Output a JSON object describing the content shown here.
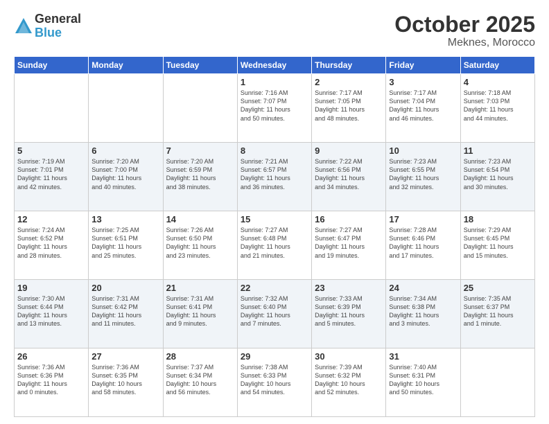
{
  "logo": {
    "general": "General",
    "blue": "Blue"
  },
  "header": {
    "month": "October 2025",
    "location": "Meknes, Morocco"
  },
  "weekdays": [
    "Sunday",
    "Monday",
    "Tuesday",
    "Wednesday",
    "Thursday",
    "Friday",
    "Saturday"
  ],
  "weeks": [
    [
      {
        "day": "",
        "info": ""
      },
      {
        "day": "",
        "info": ""
      },
      {
        "day": "",
        "info": ""
      },
      {
        "day": "1",
        "info": "Sunrise: 7:16 AM\nSunset: 7:07 PM\nDaylight: 11 hours\nand 50 minutes."
      },
      {
        "day": "2",
        "info": "Sunrise: 7:17 AM\nSunset: 7:05 PM\nDaylight: 11 hours\nand 48 minutes."
      },
      {
        "day": "3",
        "info": "Sunrise: 7:17 AM\nSunset: 7:04 PM\nDaylight: 11 hours\nand 46 minutes."
      },
      {
        "day": "4",
        "info": "Sunrise: 7:18 AM\nSunset: 7:03 PM\nDaylight: 11 hours\nand 44 minutes."
      }
    ],
    [
      {
        "day": "5",
        "info": "Sunrise: 7:19 AM\nSunset: 7:01 PM\nDaylight: 11 hours\nand 42 minutes."
      },
      {
        "day": "6",
        "info": "Sunrise: 7:20 AM\nSunset: 7:00 PM\nDaylight: 11 hours\nand 40 minutes."
      },
      {
        "day": "7",
        "info": "Sunrise: 7:20 AM\nSunset: 6:59 PM\nDaylight: 11 hours\nand 38 minutes."
      },
      {
        "day": "8",
        "info": "Sunrise: 7:21 AM\nSunset: 6:57 PM\nDaylight: 11 hours\nand 36 minutes."
      },
      {
        "day": "9",
        "info": "Sunrise: 7:22 AM\nSunset: 6:56 PM\nDaylight: 11 hours\nand 34 minutes."
      },
      {
        "day": "10",
        "info": "Sunrise: 7:23 AM\nSunset: 6:55 PM\nDaylight: 11 hours\nand 32 minutes."
      },
      {
        "day": "11",
        "info": "Sunrise: 7:23 AM\nSunset: 6:54 PM\nDaylight: 11 hours\nand 30 minutes."
      }
    ],
    [
      {
        "day": "12",
        "info": "Sunrise: 7:24 AM\nSunset: 6:52 PM\nDaylight: 11 hours\nand 28 minutes."
      },
      {
        "day": "13",
        "info": "Sunrise: 7:25 AM\nSunset: 6:51 PM\nDaylight: 11 hours\nand 25 minutes."
      },
      {
        "day": "14",
        "info": "Sunrise: 7:26 AM\nSunset: 6:50 PM\nDaylight: 11 hours\nand 23 minutes."
      },
      {
        "day": "15",
        "info": "Sunrise: 7:27 AM\nSunset: 6:48 PM\nDaylight: 11 hours\nand 21 minutes."
      },
      {
        "day": "16",
        "info": "Sunrise: 7:27 AM\nSunset: 6:47 PM\nDaylight: 11 hours\nand 19 minutes."
      },
      {
        "day": "17",
        "info": "Sunrise: 7:28 AM\nSunset: 6:46 PM\nDaylight: 11 hours\nand 17 minutes."
      },
      {
        "day": "18",
        "info": "Sunrise: 7:29 AM\nSunset: 6:45 PM\nDaylight: 11 hours\nand 15 minutes."
      }
    ],
    [
      {
        "day": "19",
        "info": "Sunrise: 7:30 AM\nSunset: 6:44 PM\nDaylight: 11 hours\nand 13 minutes."
      },
      {
        "day": "20",
        "info": "Sunrise: 7:31 AM\nSunset: 6:42 PM\nDaylight: 11 hours\nand 11 minutes."
      },
      {
        "day": "21",
        "info": "Sunrise: 7:31 AM\nSunset: 6:41 PM\nDaylight: 11 hours\nand 9 minutes."
      },
      {
        "day": "22",
        "info": "Sunrise: 7:32 AM\nSunset: 6:40 PM\nDaylight: 11 hours\nand 7 minutes."
      },
      {
        "day": "23",
        "info": "Sunrise: 7:33 AM\nSunset: 6:39 PM\nDaylight: 11 hours\nand 5 minutes."
      },
      {
        "day": "24",
        "info": "Sunrise: 7:34 AM\nSunset: 6:38 PM\nDaylight: 11 hours\nand 3 minutes."
      },
      {
        "day": "25",
        "info": "Sunrise: 7:35 AM\nSunset: 6:37 PM\nDaylight: 11 hours\nand 1 minute."
      }
    ],
    [
      {
        "day": "26",
        "info": "Sunrise: 7:36 AM\nSunset: 6:36 PM\nDaylight: 11 hours\nand 0 minutes."
      },
      {
        "day": "27",
        "info": "Sunrise: 7:36 AM\nSunset: 6:35 PM\nDaylight: 10 hours\nand 58 minutes."
      },
      {
        "day": "28",
        "info": "Sunrise: 7:37 AM\nSunset: 6:34 PM\nDaylight: 10 hours\nand 56 minutes."
      },
      {
        "day": "29",
        "info": "Sunrise: 7:38 AM\nSunset: 6:33 PM\nDaylight: 10 hours\nand 54 minutes."
      },
      {
        "day": "30",
        "info": "Sunrise: 7:39 AM\nSunset: 6:32 PM\nDaylight: 10 hours\nand 52 minutes."
      },
      {
        "day": "31",
        "info": "Sunrise: 7:40 AM\nSunset: 6:31 PM\nDaylight: 10 hours\nand 50 minutes."
      },
      {
        "day": "",
        "info": ""
      }
    ]
  ]
}
